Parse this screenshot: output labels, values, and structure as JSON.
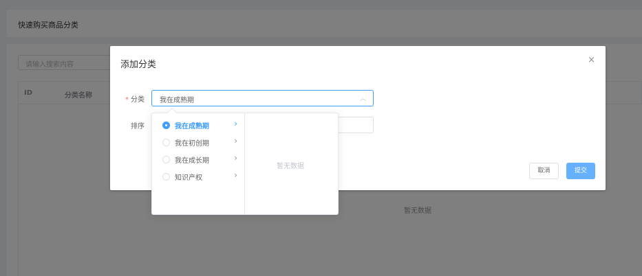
{
  "page": {
    "header_title": "快速购买商品分类",
    "search_placeholder": "请输入搜索内容",
    "table": {
      "columns": [
        "ID",
        "分类名称"
      ],
      "empty_text": "暂无数据"
    }
  },
  "dialog": {
    "title": "添加分类",
    "close_icon": "×",
    "fields": {
      "category_label": "分类",
      "required_mark": "*",
      "category_value": "我在成熟期",
      "sort_label": "排序"
    },
    "buttons": {
      "cancel": "取消",
      "submit": "提交"
    }
  },
  "cascader": {
    "options": [
      {
        "label": "我在成熟期",
        "selected": true
      },
      {
        "label": "我在初创期",
        "selected": false
      },
      {
        "label": "我在成长期",
        "selected": false
      },
      {
        "label": "知识产权",
        "selected": false
      }
    ],
    "submenu_empty": "暂无数据"
  },
  "icons": {
    "dropdown_arrow": "chevron-up-icon",
    "menu_arrow": "chevron-right-icon",
    "close": "close-icon"
  },
  "colors": {
    "primary": "#409eff",
    "submit_button": "#66b1ff",
    "required": "#f56c6c",
    "overlay": "rgba(0,0,0,0.5)"
  }
}
